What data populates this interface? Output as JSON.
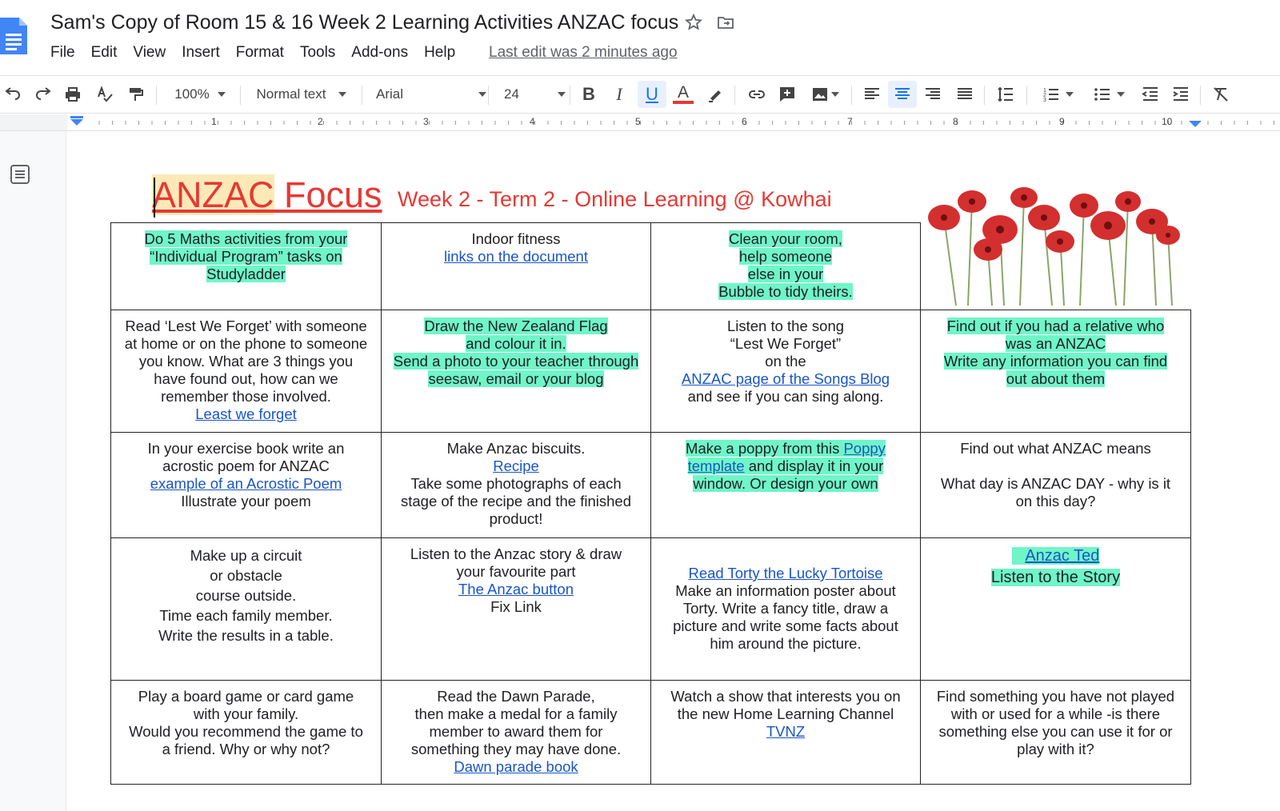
{
  "window": {
    "title": "Sam's Copy of Room 15 & 16 Week 2 Learning Activities ANZAC focus",
    "last_edit": "Last edit was 2 minutes ago"
  },
  "menu": [
    "File",
    "Edit",
    "View",
    "Insert",
    "Format",
    "Tools",
    "Add-ons",
    "Help"
  ],
  "toolbar": {
    "zoom": "100%",
    "style": "Normal text",
    "font": "Arial",
    "size": "24"
  },
  "ruler": [
    "1",
    "2",
    "3",
    "4",
    "5",
    "6",
    "7",
    "8",
    "9",
    "10"
  ],
  "document": {
    "heading_main": "ANZAC Focus",
    "heading_main_first": "ANZAC",
    "heading_main_rest": " Focus",
    "heading_sub": "Week 2 - Term 2 -  Online Learning @ Kowhai",
    "accent_color": "#e53935",
    "highlight_color": "#6ff5c8",
    "link_color": "#1a55c6"
  },
  "cells": {
    "r1c1": [
      "Do 5 Maths activities from your",
      "“Individual Program”  tasks on",
      "Studyladder"
    ],
    "r1c2_text": "Indoor fitness",
    "r1c2_link": "links on the document",
    "r1c3": [
      "Clean your room,",
      "help someone",
      "else in your",
      "Bubble to tidy theirs."
    ],
    "r2c1": [
      "Read ‘Lest We Forget’ with someone",
      "at home or on the phone to someone",
      "you know. What are 3 things you",
      "have found out, how can we",
      "remember those involved."
    ],
    "r2c1_link": "Least we forget",
    "r2c2": [
      "Draw the New Zealand Flag",
      "and colour it in.",
      "Send a photo to your teacher through",
      "seesaw, email or your blog"
    ],
    "r2c3_a": [
      "Listen to the song",
      "“Lest We Forget”",
      "on the"
    ],
    "r2c3_link": "ANZAC page of the Songs Blog",
    "r2c3_b": "and see if you can sing along.",
    "r2c4": [
      "Find out if you had a relative who",
      "was an ANZAC",
      "Write any information you can find",
      "out about them"
    ],
    "r3c1_a": [
      "In your exercise book write an",
      "acrostic poem for ANZAC"
    ],
    "r3c1_link": "example of an Acrostic Poem",
    "r3c1_b": "Illustrate your poem",
    "r3c2_a": "Make Anzac biscuits.",
    "r3c2_link": "Recipe",
    "r3c2_b": [
      "Take some photographs of each",
      "stage of the recipe and the finished",
      "product!"
    ],
    "r3c3_a": "Make a poppy from this",
    "r3c3_link1": "Poppy",
    "r3c3_link2": "template",
    "r3c3_b": "and display it in your",
    "r3c3_c": "window.  Or design your own",
    "r3c4_a": "Find out what ANZAC means",
    "r3c4_b": [
      "What day is ANZAC DAY - why is it",
      "on this day?"
    ],
    "r4c1": [
      "Make up a circuit",
      "or obstacle",
      "course outside.",
      "Time each family member.",
      "Write the results in a table."
    ],
    "r4c2_a": [
      "Listen to the Anzac story & draw",
      "your favourite part"
    ],
    "r4c2_link": "The Anzac button",
    "r4c2_b": "Fix Link",
    "r4c3_link": "Read Torty the Lucky Tortoise",
    "r4c3": [
      "Make an information poster about",
      "Torty. Write a fancy title, draw a",
      "picture and write some facts about",
      "him around the picture."
    ],
    "r4c4_link": "Anzac Ted",
    "r4c4_b": "Listen to the Story",
    "r5c1": [
      "Play a board game or card game",
      "with your family.",
      "Would you recommend the game to",
      "a friend. Why or why not?"
    ],
    "r5c2": [
      "Read the Dawn Parade,",
      "then make a medal for a family",
      "member to award them for",
      "something they may have done."
    ],
    "r5c2_link": "Dawn parade book",
    "r5c3": [
      "Watch a show that interests you on",
      "the new Home Learning Channel"
    ],
    "r5c3_link": "TVNZ",
    "r5c4": [
      "Find something you have not played",
      "with or used for a while -is there",
      "something else you can use it for or",
      "play with it?"
    ]
  }
}
